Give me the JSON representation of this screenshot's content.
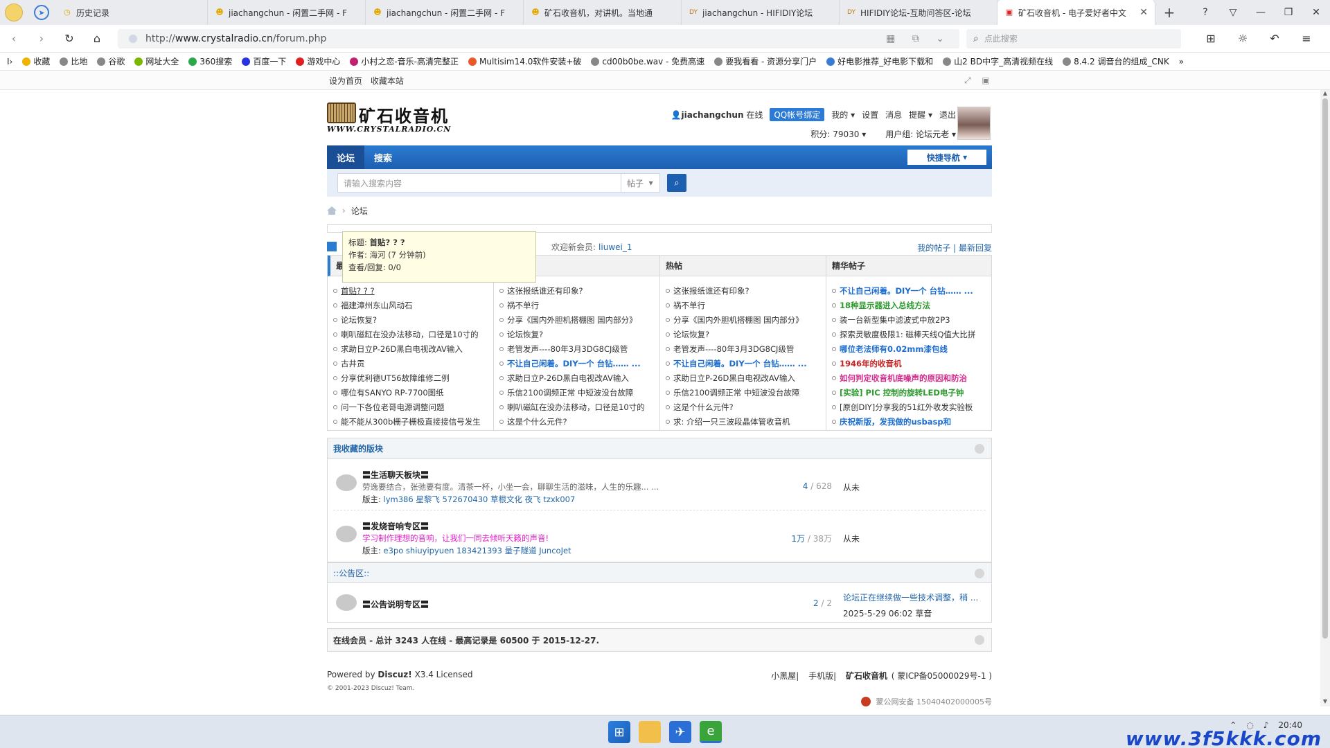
{
  "browser": {
    "tabs": [
      {
        "label": "历史记录",
        "icon": "clock-icon"
      },
      {
        "label": "jiachangchun - 闲置二手网 - F",
        "icon": "smiley-icon"
      },
      {
        "label": "jiachangchun - 闲置二手网 - F",
        "icon": "smiley-icon"
      },
      {
        "label": "矿石收音机，对讲机。当地通",
        "icon": "smiley-icon"
      },
      {
        "label": "jiachangchun - HIFIDIY论坛",
        "icon": "diy-icon"
      },
      {
        "label": "HIFIDIY论坛-互助问答区-论坛",
        "icon": "diy-icon"
      },
      {
        "label": "矿石收音机 - 电子爱好者中文",
        "icon": "radio-icon",
        "active": true
      }
    ],
    "url_prefix": "http://",
    "url_host": "www.crystalradio.cn",
    "url_path": "/forum.php",
    "search_placeholder": "点此搜索",
    "bookmarks": [
      {
        "label": "收藏",
        "color": "#f0b400"
      },
      {
        "label": "比地",
        "color": "#888"
      },
      {
        "label": "谷歌",
        "color": "#888"
      },
      {
        "label": "网址大全",
        "color": "#7ab900"
      },
      {
        "label": "360搜索",
        "color": "#2aa84a"
      },
      {
        "label": "百度一下",
        "color": "#2932e1"
      },
      {
        "label": "游戏中心",
        "color": "#e02020"
      },
      {
        "label": "小村之恋-音乐-高清完整正",
        "color": "#c02070"
      },
      {
        "label": "Multisim14.0软件安装+破",
        "color": "#e85a2a"
      },
      {
        "label": "cd00b0be.wav - 免费高速",
        "color": "#888"
      },
      {
        "label": "要我看看 - 资源分享门户",
        "color": "#888"
      },
      {
        "label": "好电影推荐_好电影下载和",
        "color": "#3a7bd5"
      },
      {
        "label": "山2 BD中字_高清视频在线",
        "color": "#888"
      },
      {
        "label": "8.4.2 调音台的组成_CNK",
        "color": "#888"
      }
    ]
  },
  "sitebar": {
    "set_home": "设为首页",
    "bookmark": "收藏本站"
  },
  "header": {
    "logo_cn": "矿石收音机",
    "logo_en": "WWW.CRYSTALRADIO.CN",
    "username": "jiachangchun",
    "online": "在线",
    "qq_bind": "QQ帐号绑定",
    "my": "我的",
    "settings": "设置",
    "messages": "消息",
    "remind": "提醒",
    "logout": "退出",
    "points": "积分: 79030",
    "usergroup": "用户组: 论坛元老"
  },
  "nav": {
    "forum": "论坛",
    "search": "搜索",
    "quick_nav": "快捷导航"
  },
  "search": {
    "placeholder": "请输入搜索内容",
    "type": "帖子"
  },
  "breadcrumb": {
    "current": "论坛"
  },
  "stats": {
    "welcome": "欢迎新会员:",
    "new_member": "liuwei_1",
    "my_posts": "我的帖子",
    "latest_replies": "最新回复"
  },
  "tooltip": {
    "title_label": "标题:",
    "title": "首贴? ? ?",
    "author_label": "作者:",
    "author": "海河 (7 分钟前)",
    "views_label": "查看/回复:",
    "views": "0/0"
  },
  "grid": {
    "columns": [
      {
        "header": "最",
        "items": [
          {
            "t": "首贴? ? ?",
            "c": ""
          },
          {
            "t": "福建漳州东山风动石",
            "c": ""
          },
          {
            "t": "论坛恢复?",
            "c": ""
          },
          {
            "t": "喇叭磁缸在没办法移动，口径是10寸的",
            "c": ""
          },
          {
            "t": "求助日立P-26D黑白电视改AV输入",
            "c": ""
          },
          {
            "t": "古井贡",
            "c": ""
          },
          {
            "t": "分享优利德UT56故障维修二例",
            "c": ""
          },
          {
            "t": "哪位有SANYO RP-7700图纸",
            "c": ""
          },
          {
            "t": "问一下各位老哥电源调整问题",
            "c": ""
          },
          {
            "t": "能不能从300b栅子栅极直接接信号发生",
            "c": ""
          }
        ]
      },
      {
        "header": "",
        "items": [
          {
            "t": "这张报纸谁还有印象?",
            "c": ""
          },
          {
            "t": "祸不单行",
            "c": ""
          },
          {
            "t": "分享《国内外胆机搭棚图 国内部分》",
            "c": ""
          },
          {
            "t": "论坛恢复?",
            "c": ""
          },
          {
            "t": "老管发声----80年3月3DG8CJ级管",
            "c": ""
          },
          {
            "t": "不让自己闲着。DIY一个 台钻…… ...",
            "c": "blue"
          },
          {
            "t": "求助日立P-26D黑白电视改AV输入",
            "c": ""
          },
          {
            "t": "乐信2100调频正常 中短波没台故障",
            "c": ""
          },
          {
            "t": "喇叭磁缸在没办法移动，口径是10寸的",
            "c": ""
          },
          {
            "t": "这是个什么元件?",
            "c": ""
          }
        ]
      },
      {
        "header": "热帖",
        "items": [
          {
            "t": "这张报纸谁还有印象?",
            "c": ""
          },
          {
            "t": "祸不单行",
            "c": ""
          },
          {
            "t": "分享《国内外胆机搭棚图 国内部分》",
            "c": ""
          },
          {
            "t": "论坛恢复?",
            "c": ""
          },
          {
            "t": "老管发声----80年3月3DG8CJ级管",
            "c": ""
          },
          {
            "t": "不让自己闲着。DIY一个 台钻…… ...",
            "c": "blue"
          },
          {
            "t": "求助日立P-26D黑白电视改AV输入",
            "c": ""
          },
          {
            "t": "乐信2100调频正常 中短波没台故障",
            "c": ""
          },
          {
            "t": "这是个什么元件?",
            "c": ""
          },
          {
            "t": "求: 介绍一只三波段晶体管收音机",
            "c": ""
          }
        ]
      },
      {
        "header": "精华帖子",
        "items": [
          {
            "t": "不让自己闲着。DIY一个 台钻…… ...",
            "c": "blue"
          },
          {
            "t": "18种显示器进入总线方法",
            "c": "green"
          },
          {
            "t": "装一台新型集中滤波式中放2P3",
            "c": ""
          },
          {
            "t": "探索灵敏度极限1: 磁棒天线Q值大比拼",
            "c": ""
          },
          {
            "t": "哪位老法师有0.02mm漆包线",
            "c": "blue"
          },
          {
            "t": "1946年的收音机",
            "c": "dred"
          },
          {
            "t": "如何判定收音机底噪声的原因和防治",
            "c": "pink"
          },
          {
            "t": "[实验] PIC 控制的旋转LED电子钟",
            "c": "green"
          },
          {
            "t": "[原创DIY]分享我的51红外收发实验板",
            "c": ""
          },
          {
            "t": "庆祝新版，发我做的usbasp和",
            "c": "blue"
          }
        ]
      }
    ]
  },
  "favorites": {
    "title": "我收藏的版块",
    "forums": [
      {
        "name": "〓生活聊天板块〓",
        "desc": "劳逸要结合，张弛要有度。清茶一杯，小坐一会，聊聊生活的滋味，人生的乐趣... ...",
        "desc_color": "normal",
        "mods_label": "版主:",
        "mods": "lym386 星黎飞 572670430 草根文化 夜飞 tzxk007",
        "threads": "4",
        "posts": "628",
        "last": "从未"
      },
      {
        "name": "〓发烧音响专区〓",
        "desc": "学习制作理想的音响，让我们一同去倾听天籁的声音!",
        "desc_color": "pink",
        "mods_label": "版主:",
        "mods": "e3po shiuyipyuen 183421393 量子隧道 JuncoJet",
        "threads": "1万",
        "posts": "38万",
        "last": "从未"
      }
    ]
  },
  "announce": {
    "title": "::公告区::",
    "forum_name": "〓公告说明专区〓",
    "threads": "2",
    "posts": "2",
    "last_title": "论坛正在继续做一些技术调整，稍 ...",
    "last_meta": "2025-5-29 06:02 草音"
  },
  "online": {
    "text": "在线会员 - 总计 3243 人在线 - 最高记录是 60500 于 2015-12-27."
  },
  "footer": {
    "powered_by": "Powered by",
    "discuz": "Discuz!",
    "version": "X3.4 Licensed",
    "copyright": "© 2001-2023 Discuz! Team.",
    "link1": "小黑屋",
    "link2": "手机版",
    "site_name": "矿石收音机",
    "icp": "( 蒙ICP备05000029号-1 )",
    "beian": "蒙公网安备 15040402000005号"
  },
  "taskbar": {
    "time": "20:40"
  },
  "watermark": "www.3f5kkk.com"
}
